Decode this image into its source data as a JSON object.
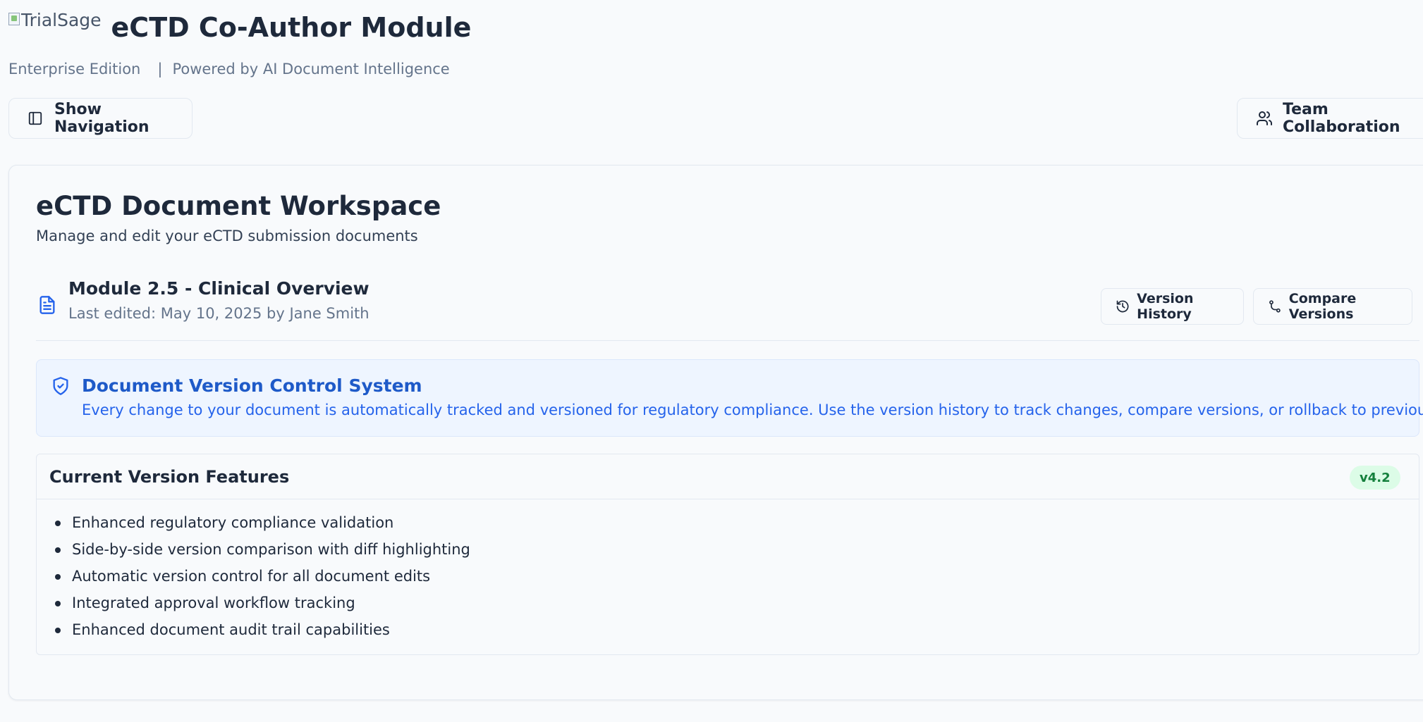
{
  "header": {
    "logo_alt": "TrialSage",
    "title": "eCTD Co-Author Module",
    "edition": "Enterprise Edition",
    "separator": "|",
    "powered_by": "Powered by AI Document Intelligence"
  },
  "toolbar": {
    "show_navigation_label": "Show Navigation",
    "team_collaboration_label": "Team Collaboration"
  },
  "workspace": {
    "title": "eCTD Document Workspace",
    "subtitle": "Manage and edit your eCTD submission documents",
    "document": {
      "name": "Module 2.5 - Clinical Overview",
      "last_edited": "Last edited: May 10, 2025 by Jane Smith"
    },
    "actions": {
      "version_history_label": "Version History",
      "compare_versions_label": "Compare Versions"
    }
  },
  "alert": {
    "title": "Document Version Control System",
    "text": "Every change to your document is automatically tracked and versioned for regulatory compliance. Use the version history to track changes, compare versions, or rollback to previous states."
  },
  "features": {
    "title": "Current Version Features",
    "version_badge": "v4.2",
    "items": [
      "Enhanced regulatory compliance validation",
      "Side-by-side version comparison with diff highlighting",
      "Automatic version control for all document edits",
      "Integrated approval workflow tracking",
      "Enhanced document audit trail capabilities"
    ]
  },
  "colors": {
    "background": "#f8fafc",
    "accent_blue": "#2563eb",
    "alert_bg": "#eef5ff",
    "badge_green_bg": "#dcfce7",
    "badge_green_text": "#15803d"
  },
  "icons": {
    "show_navigation": "sidebar-panel-icon",
    "team_collaboration": "users-icon",
    "document": "file-text-icon",
    "version_history": "history-icon",
    "compare_versions": "git-compare-icon",
    "alert": "shield-check-icon"
  }
}
